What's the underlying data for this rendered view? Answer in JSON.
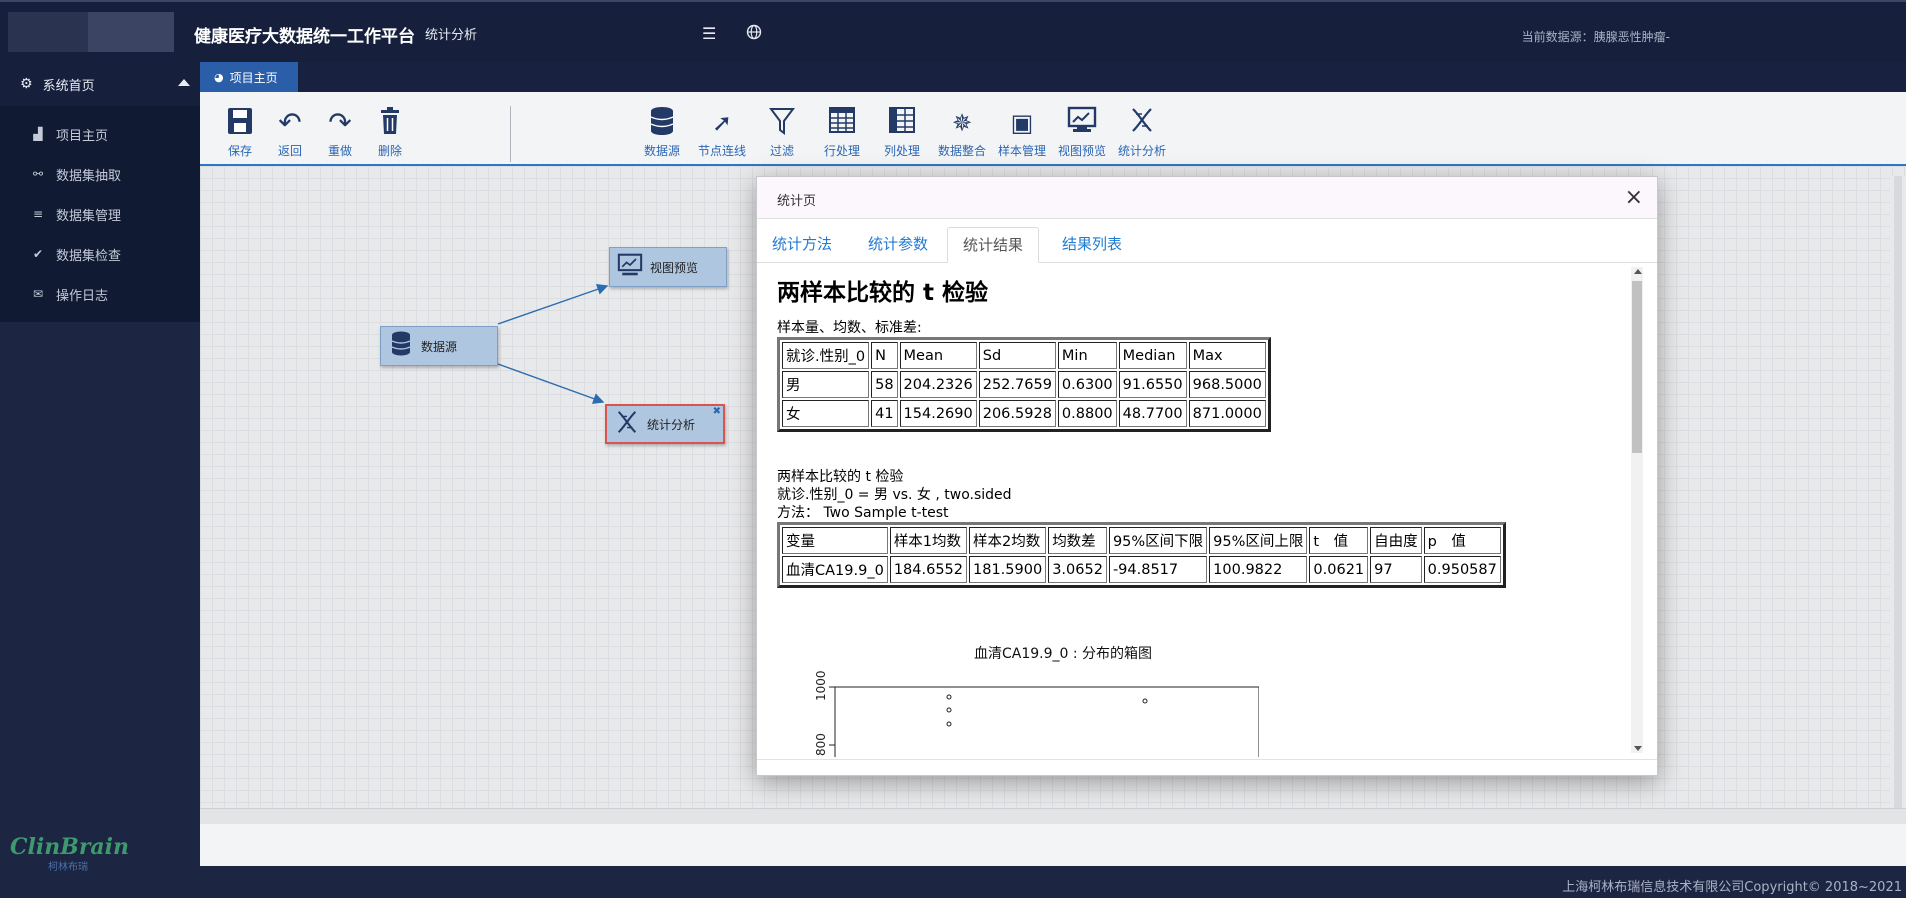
{
  "header": {
    "app_title": "健康医疗大数据统一工作平台",
    "app_sub": "统计分析",
    "menu_icon": "menu-icon",
    "globe_icon": "globe-icon",
    "right_text": "当前数据源：胰腺恶性肿瘤-"
  },
  "sidebar": {
    "home": "系统首页",
    "items": [
      {
        "label": "项目主页",
        "icon": "chart-icon"
      },
      {
        "label": "数据集抽取",
        "icon": "extract-icon"
      },
      {
        "label": "数据集管理",
        "icon": "list-icon"
      },
      {
        "label": "数据集检查",
        "icon": "check-icon"
      },
      {
        "label": "操作日志",
        "icon": "log-icon"
      }
    ],
    "brand": "ClinBrain",
    "brand_cn": "柯林布瑞"
  },
  "tabbar": {
    "tab": "项目主页"
  },
  "toolbar": {
    "left": [
      "保存",
      "返回",
      "重做",
      "删除"
    ],
    "right": [
      "数据源",
      "节点连线",
      "过滤",
      "行处理",
      "列处理",
      "数据整合",
      "样本管理",
      "视图预览",
      "统计分析"
    ]
  },
  "canvas": {
    "nodes": {
      "datasource": "数据源",
      "preview": "视图预览",
      "stats": "统计分析"
    }
  },
  "modal": {
    "title": "统计页",
    "tabs": [
      "统计方法",
      "统计参数",
      "统计结果",
      "结果列表"
    ],
    "active_tab": "统计结果",
    "heading": "两样本比较的 t 检验",
    "desc_label": "样本量、均数、标准差:",
    "table1": {
      "headers": [
        "就诊.性别_0",
        "N",
        "Mean",
        "Sd",
        "Min",
        "Median",
        "Max"
      ],
      "rows": [
        [
          "男",
          "58",
          "204.2326",
          "252.7659",
          "0.6300",
          "91.6550",
          "968.5000"
        ],
        [
          "女",
          "41",
          "154.2690",
          "206.5928",
          "0.8800",
          "48.7700",
          "871.0000"
        ]
      ]
    },
    "test_lines": [
      "两样本比较的 t 检验",
      "就诊.性别_0 = 男 vs. 女 , two.sided",
      "方法： Two Sample t-test"
    ],
    "table2": {
      "headers": [
        "变量",
        "样本1均数",
        "样本2均数",
        "均数差",
        "95%区间下限",
        "95%区间上限",
        "t　值",
        "自由度",
        "p　值"
      ],
      "rows": [
        [
          "血清CA19.9_0",
          "184.6552",
          "181.5900",
          "3.0652",
          "-94.8517",
          "100.9822",
          "0.0621",
          "97",
          "0.950587"
        ]
      ]
    },
    "plot": {
      "title": "血清CA19.9_0 : 分布的箱图",
      "y_ticks": [
        "1000",
        "800"
      ]
    }
  },
  "footer": {
    "copyright": "上海柯林布瑞信息技术有限公司Copyright© 2018~2021"
  }
}
